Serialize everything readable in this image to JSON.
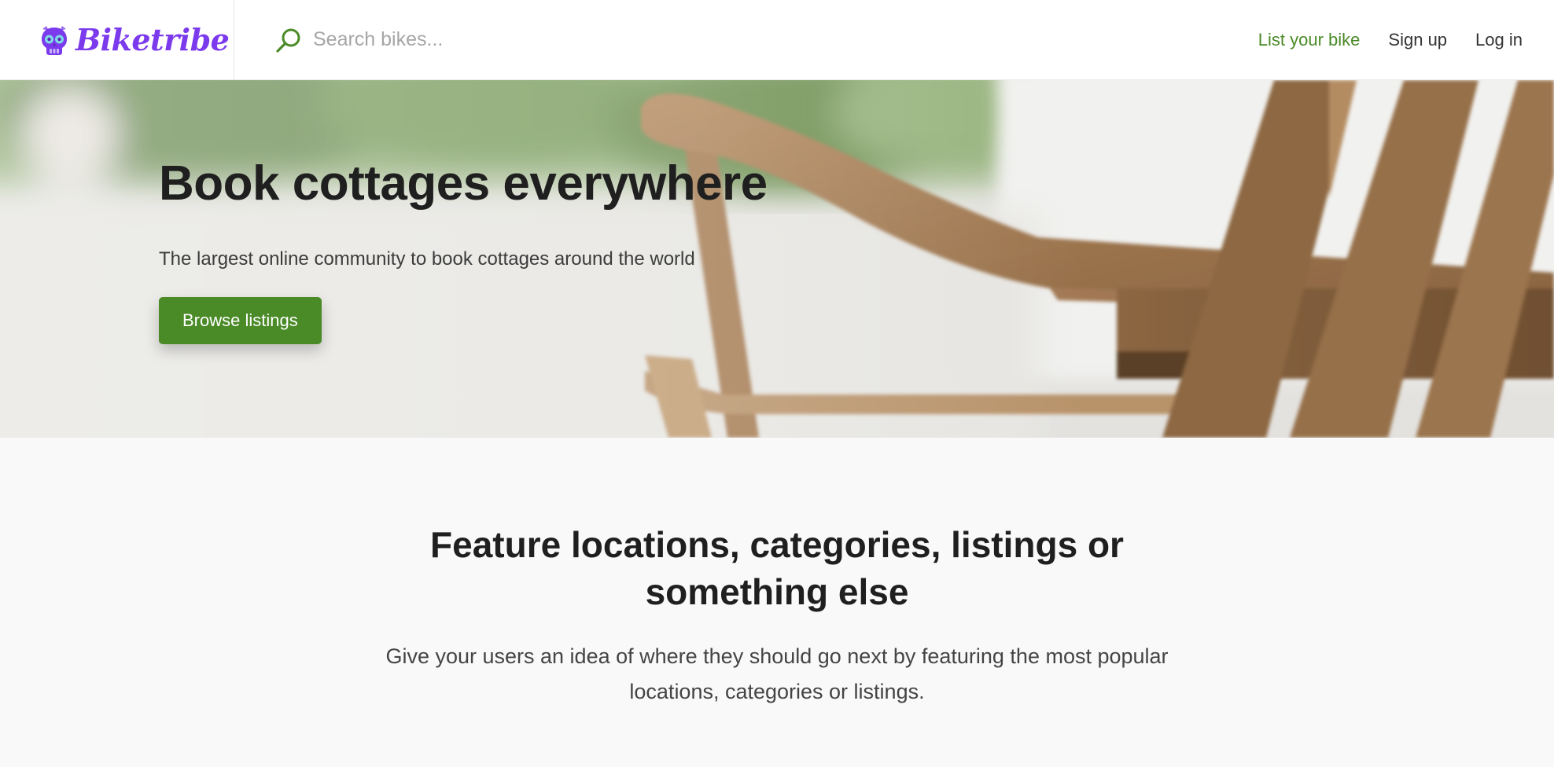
{
  "brand": {
    "name": "Biketribe",
    "icon": "skull-logo-icon",
    "color": "#7c3aed"
  },
  "search": {
    "placeholder": "Search bikes...",
    "value": "",
    "icon": "search-icon"
  },
  "nav": {
    "list_bike": "List your bike",
    "sign_up": "Sign up",
    "log_in": "Log in"
  },
  "hero": {
    "title": "Book cottages everywhere",
    "subtitle": "The largest online community to book cottages around the world",
    "button_label": "Browse listings",
    "image": "wooden-chair-photo"
  },
  "featured": {
    "heading": "Feature locations, categories, listings or something else",
    "body": "Give your users an idea of where they should go next by featuring the most popular locations, categories or listings."
  },
  "colors": {
    "accent": "#4a8a27",
    "brand": "#7c3aed",
    "page_bg": "#f9f9f9"
  }
}
